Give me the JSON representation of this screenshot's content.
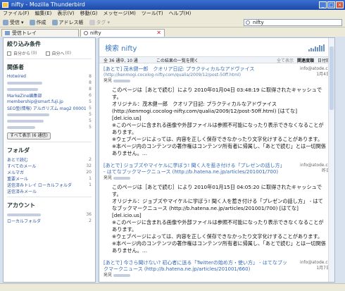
{
  "window": {
    "title": "nifty - Mozilla Thunderbird"
  },
  "menu": [
    "ファイル(F)",
    "編集(E)",
    "表示(V)",
    "移動(G)",
    "メッセージ(M)",
    "ツール(T)",
    "ヘルプ(H)"
  ],
  "toolbar": {
    "receive": "受信",
    "compose": "作成",
    "address": "アドレス帳",
    "tag": "タグ"
  },
  "search": {
    "value": "nifty"
  },
  "tabs": [
    "受信トレイ",
    "nifty"
  ],
  "sidebar": {
    "filter_title": "絞り込み条件",
    "check1": "自分から",
    "check1_count": "(0)",
    "check2": "自分へ",
    "check2_count": "(0)",
    "senders_title": "関係者",
    "senders": [
      {
        "label": "Hotwired",
        "count": "8"
      },
      {
        "label": "",
        "count": "8"
      },
      {
        "label": "",
        "count": "8"
      },
      {
        "label": "MarkeZine編集部",
        "count": "6"
      },
      {
        "label": "membership@smart.fuji.jp",
        "count": "5"
      },
      {
        "label": "SEO塾(情報) アルガリズム mag2 0000114915",
        "count": "5"
      },
      {
        "label": "",
        "count": "5"
      },
      {
        "label": "",
        "count": "5"
      },
      {
        "label": "",
        "count": "5"
      }
    ],
    "show_all": "すべて表示 (6 通信)",
    "folders_title": "フォルダ",
    "folders": [
      {
        "label": "あとで読む",
        "count": "2"
      },
      {
        "label": "すべてのメール",
        "count": "32"
      },
      {
        "label": "メルマガ",
        "count": "20"
      },
      {
        "label": "重要メール",
        "count": "1"
      },
      {
        "label": "送信済みトレイ ローカルフォルダ",
        "count": "1"
      },
      {
        "label": "送信済みメール",
        "count": ""
      }
    ],
    "accounts_title": "アカウント",
    "accounts": [
      {
        "label": "",
        "count": "36"
      },
      {
        "label": "ローカルフォルダ",
        "count": "2"
      }
    ]
  },
  "main": {
    "heading": "検索 nifty",
    "sort_count": "全 36 通中, 10 通",
    "sort_center": "この結果の一覧を開く",
    "sort_all": "全て表示",
    "sort_relevance": "関連度順",
    "sort_date": "日付順",
    "results": [
      {
        "title": "[あとで] 茂木健一郎　クオリア日記: プラクティカルなアドヴァイス",
        "url": "(http://kenmogi.cocolog-nifty.com/qualia/2009/12/post-50ff.html)",
        "from": "発見",
        "to": "info@atode.cc",
        "date": "1月4日",
        "body": "このページは［あとで読む］により 2010年01月04日 03:48:19 に取得されたキャッシュです。\nオリジナル：茂木健一郎　クオリア日記: プラクティカルなアドヴァイス (http://kenmogi.cocolog-nifty.com/qualia/2009/12/post-50ff.html) [はてな] [del.icio.us]\n※このページに含まれる画像や外部ファイルは参照不可能になったり表示できなくなることがあります。\n※ウェブページによっては、内容を正しく保存できなかったり文字化けすることがあります。\n※本ページ内のコンテンツの著作権はコンテンツ所有者に帰属し、「あとで読む」とは一切関係ありません。…"
      },
      {
        "title": "[あとで] ジョブズやマイケルに学ぼう! 聞く人を惹き付ける「プレゼンの話し方」 - はてなブックマークニュース (http://b.hatena.ne.jp/articles/201001/700)",
        "url": "",
        "from": "発見",
        "to": "info@atode.cc",
        "date": "昨日",
        "body": "このページは［あとで読む］により 2010年01月15日 04:05:20 に取得されたキャッシュです。\nオリジナル：ジョブズやマイケルに学ぼう! 聞く人を惹き付ける「プレゼンの話し方」 - はてなブックマークニュース (http://b.hatena.ne.jp/articles/201001/700) [はてな] [del.icio.us]\n※このページに含まれる画像や外部ファイルは参照不可能になったり表示できなくなることがあります。\n※ウェブページによっては、内容を正しく保存できなかったり文字化けすることがあります。\n※本ページ内のコンテンツの著作権はコンテンツ所有者に帰属し、「あとで読む」とは一切関係ありません。…"
      },
      {
        "title": "[あとで] 今さら聞けない? 初心者に送る「Twitterの始め方・使い方」 - はてなブックマークニュース (http://b.hatena.ne.jp/articles/201001/660)",
        "url": "",
        "from": "発見",
        "to": "info@atode.cc",
        "date": "1月7日",
        "body": ""
      }
    ]
  }
}
